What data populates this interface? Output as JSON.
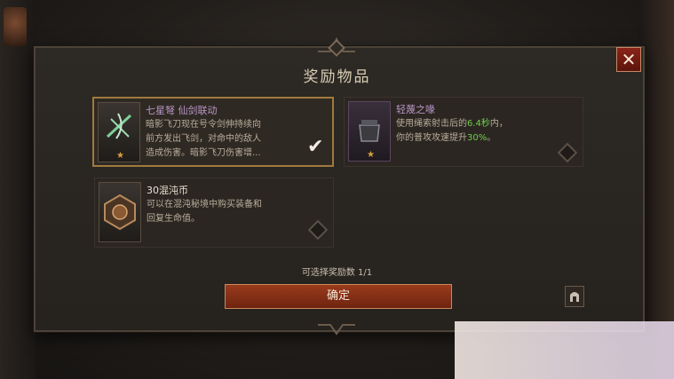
{
  "title": "奖励物品",
  "close_label": "✕",
  "rewards": [
    {
      "name": "七星弩 仙剑联动",
      "description": [
        "暗影飞刀现在号令剑伸持续向",
        "前方发出飞剑，对命中的敌人",
        "造成伤害。暗影飞刀伤害增..."
      ],
      "stars": "★",
      "selected": true,
      "check": "✔"
    },
    {
      "name": "轻蔑之喙",
      "description_lines": [
        {
          "before": "使用绳索射击后的",
          "highlight": "6.4秒",
          "after": "内，"
        },
        {
          "before": "你的普攻攻速提升",
          "highlight": "30%",
          "after": "。"
        }
      ],
      "stars": "★",
      "selected": false
    },
    {
      "name": "30混沌币",
      "description": [
        "可以在混沌秘境中购买装备和",
        "回复生命值。"
      ],
      "selected": false
    }
  ],
  "selection_count": "可选择奖励数 1/1",
  "confirm_label": "确定",
  "colors": {
    "accent_purple": "#b996c8",
    "highlight_green": "#6fcf4a",
    "button_red": "#8a2f16",
    "gold": "#d7a13b"
  }
}
